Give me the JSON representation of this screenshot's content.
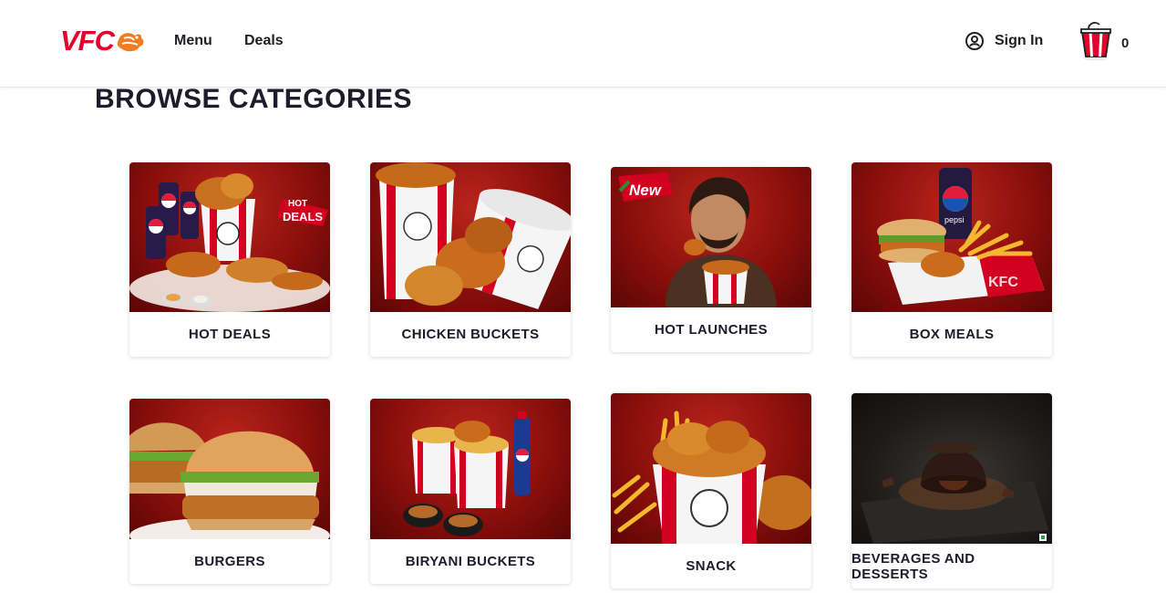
{
  "brand": {
    "logo_text": "VFC",
    "accent": "#e4002b"
  },
  "nav": {
    "menu": "Menu",
    "deals": "Deals"
  },
  "account": {
    "signin_label": "Sign In",
    "icon": "user-circle-icon"
  },
  "cart": {
    "count": "0",
    "icon": "bucket-cart-icon"
  },
  "page": {
    "title": "BROWSE CATEGORIES"
  },
  "categories": [
    {
      "label": "HOT DEALS",
      "image": "deals-bucket-image",
      "badge_top": "HOT",
      "badge_bottom": "DEALS"
    },
    {
      "label": "CHICKEN BUCKETS",
      "image": "chicken-bucket-image"
    },
    {
      "label": "HOT LAUNCHES",
      "image": "new-launch-image",
      "badge": "New"
    },
    {
      "label": "BOX MEALS",
      "image": "box-meal-image",
      "box_text": "KFC",
      "drink_text": "pepsi"
    },
    {
      "label": "BURGERS",
      "image": "burger-image"
    },
    {
      "label": "BIRYANI BUCKETS",
      "image": "biryani-bucket-image"
    },
    {
      "label": "SNACK",
      "image": "snack-bucket-image"
    },
    {
      "label": "BEVERAGES AND DESSERTS",
      "image": "lava-cake-image"
    }
  ]
}
